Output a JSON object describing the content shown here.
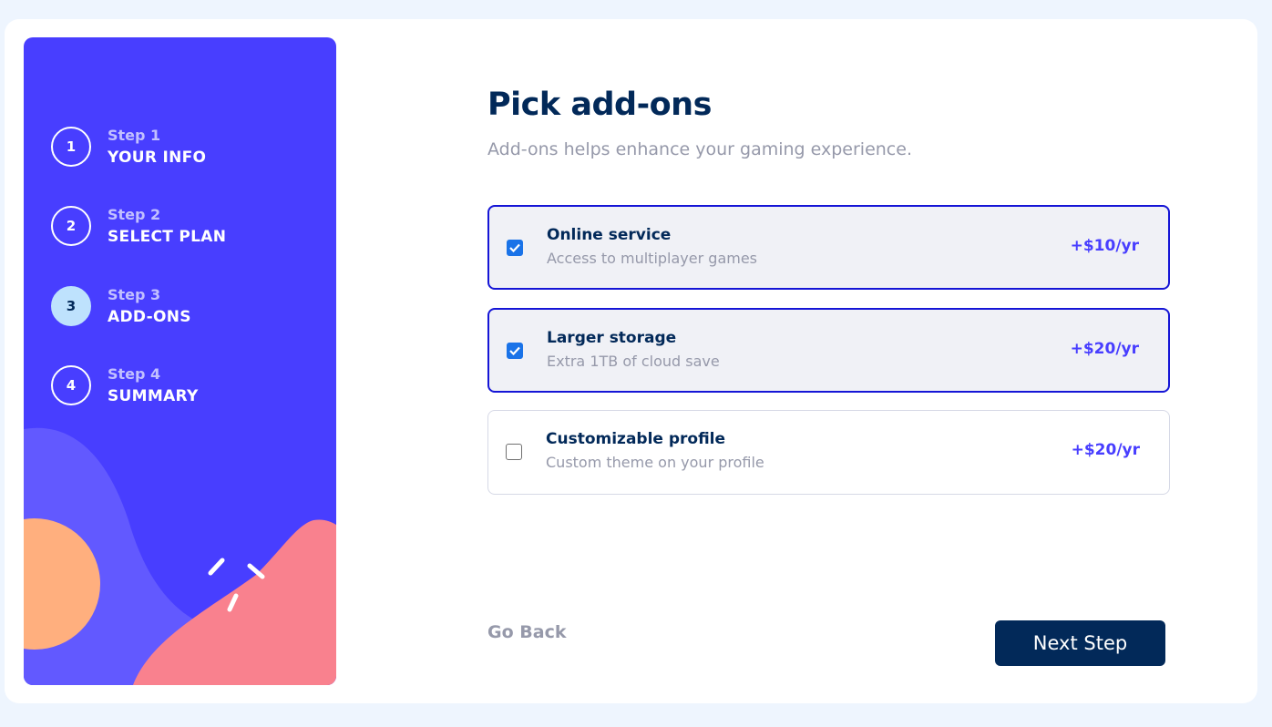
{
  "steps": [
    {
      "number": "1",
      "label": "Step 1",
      "title": "YOUR INFO",
      "active": false
    },
    {
      "number": "2",
      "label": "Step 2",
      "title": "SELECT PLAN",
      "active": false
    },
    {
      "number": "3",
      "label": "Step 3",
      "title": "ADD-ONS",
      "active": true
    },
    {
      "number": "4",
      "label": "Step 4",
      "title": "SUMMARY",
      "active": false
    }
  ],
  "main": {
    "title": "Pick add-ons",
    "subtitle": "Add-ons helps enhance your gaming experience."
  },
  "addons": [
    {
      "name": "Online service",
      "description": "Access to multiplayer games",
      "price": "+$10/yr",
      "checked": true
    },
    {
      "name": "Larger storage",
      "description": "Extra 1TB of cloud save",
      "price": "+$20/yr",
      "checked": true
    },
    {
      "name": "Customizable profile",
      "description": "Custom theme on your profile",
      "price": "+$20/yr",
      "checked": false
    }
  ],
  "footer": {
    "back_label": "Go Back",
    "next_label": "Next Step"
  },
  "colors": {
    "sidebar": "#483eff",
    "denim": "#022959",
    "active_step": "#bee2fd",
    "selected_border": "#1515d6",
    "price": "#483eff",
    "checkbox": "#1a73e8"
  },
  "icons": {
    "checkbox_checked": "checkmark-icon"
  }
}
